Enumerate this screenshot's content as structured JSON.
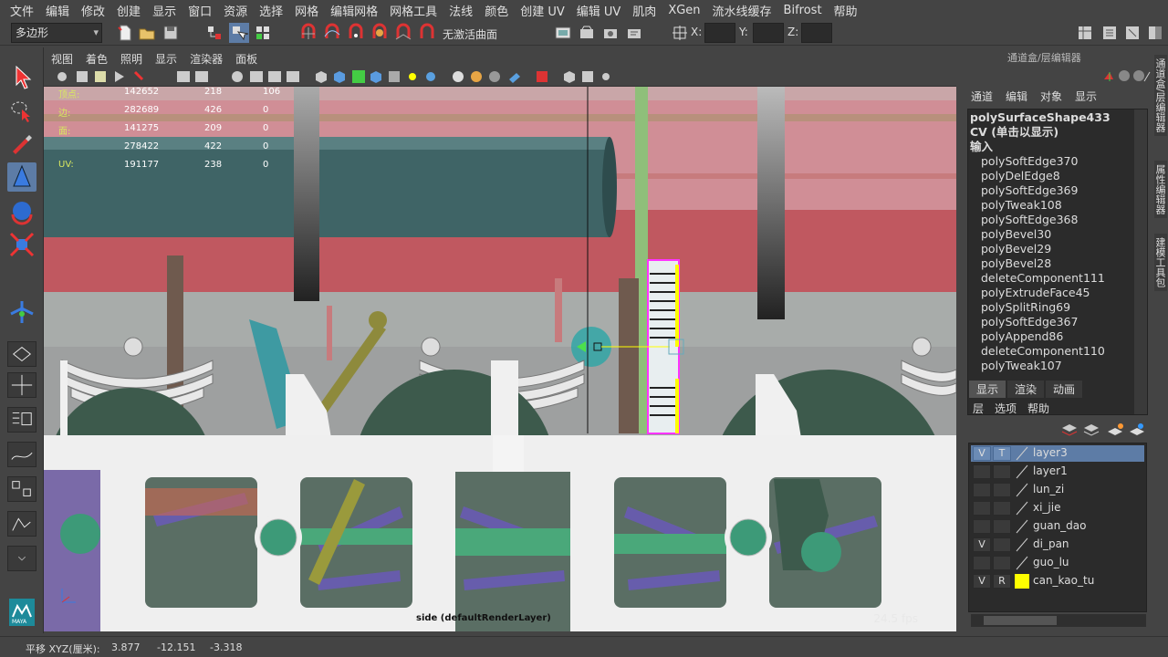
{
  "menubar": [
    "文件",
    "编辑",
    "修改",
    "创建",
    "显示",
    "窗口",
    "资源",
    "选择",
    "网格",
    "编辑网格",
    "网格工具",
    "法线",
    "颜色",
    "创建 UV",
    "编辑 UV",
    "肌肉",
    "XGen",
    "流水线缓存",
    "Bifrost",
    "帮助"
  ],
  "toolbar": {
    "mode": "多边形",
    "no_live_surface": "无激活曲面",
    "x_label": "X:",
    "y_label": "Y:",
    "z_label": "Z:"
  },
  "viewport": {
    "menu": [
      "视图",
      "着色",
      "照明",
      "显示",
      "渲染器",
      "面板"
    ],
    "hud": [
      {
        "label": "顶点:",
        "v1": "142652",
        "v2": "218",
        "v3": "106"
      },
      {
        "label": "边:",
        "v1": "282689",
        "v2": "426",
        "v3": "0"
      },
      {
        "label": "面:",
        "v1": "141275",
        "v2": "209",
        "v3": "0"
      },
      {
        "label": "",
        "v1": "278422",
        "v2": "422",
        "v3": "0"
      },
      {
        "label": "UV:",
        "v1": "191177",
        "v2": "238",
        "v3": "0"
      }
    ],
    "camera_label": "side (defaultRenderLayer)",
    "fps": "24.5 fps"
  },
  "right_panel": {
    "title": "通道盒/层编辑器",
    "cb_menu": [
      "通道",
      "编辑",
      "对象",
      "显示"
    ],
    "cb_items": [
      "polySurfaceShape433",
      "CV (单击以显示)",
      "输入",
      "polySoftEdge370",
      "polyDelEdge8",
      "polySoftEdge369",
      "polyTweak108",
      "polySoftEdge368",
      "polyBevel30",
      "polyBevel29",
      "polyBevel28",
      "deleteComponent111",
      "polyExtrudeFace45",
      "polySplitRing69",
      "polySoftEdge367",
      "polyAppend86",
      "deleteComponent110",
      "polyTweak107"
    ],
    "le_tabs": [
      "显示",
      "渲染",
      "动画"
    ],
    "le_menu": [
      "层",
      "选项",
      "帮助"
    ],
    "layers": [
      {
        "v": "V",
        "t": "T",
        "name": "layer3",
        "color": "#5d7ca6",
        "selected": true
      },
      {
        "v": "",
        "t": "",
        "name": "layer1",
        "color": "",
        "selected": false
      },
      {
        "v": "",
        "t": "",
        "name": "lun_zi",
        "color": "",
        "selected": false
      },
      {
        "v": "",
        "t": "",
        "name": "xi_jie",
        "color": "",
        "selected": false
      },
      {
        "v": "",
        "t": "",
        "name": "guan_dao",
        "color": "",
        "selected": false
      },
      {
        "v": "V",
        "t": "",
        "name": "di_pan",
        "color": "",
        "selected": false
      },
      {
        "v": "",
        "t": "",
        "name": "guo_lu",
        "color": "",
        "selected": false
      },
      {
        "v": "V",
        "t": "R",
        "name": "can_kao_tu",
        "color": "#ffff00",
        "selected": false
      }
    ],
    "side_tabs": [
      "通道盒/层编辑器",
      "属性编辑器",
      "建模工具包"
    ]
  },
  "status": {
    "label": "平移 XYZ(厘米):",
    "x": "3.877",
    "y": "-12.151",
    "z": "-3.318"
  },
  "maya_logo": "MAYA"
}
